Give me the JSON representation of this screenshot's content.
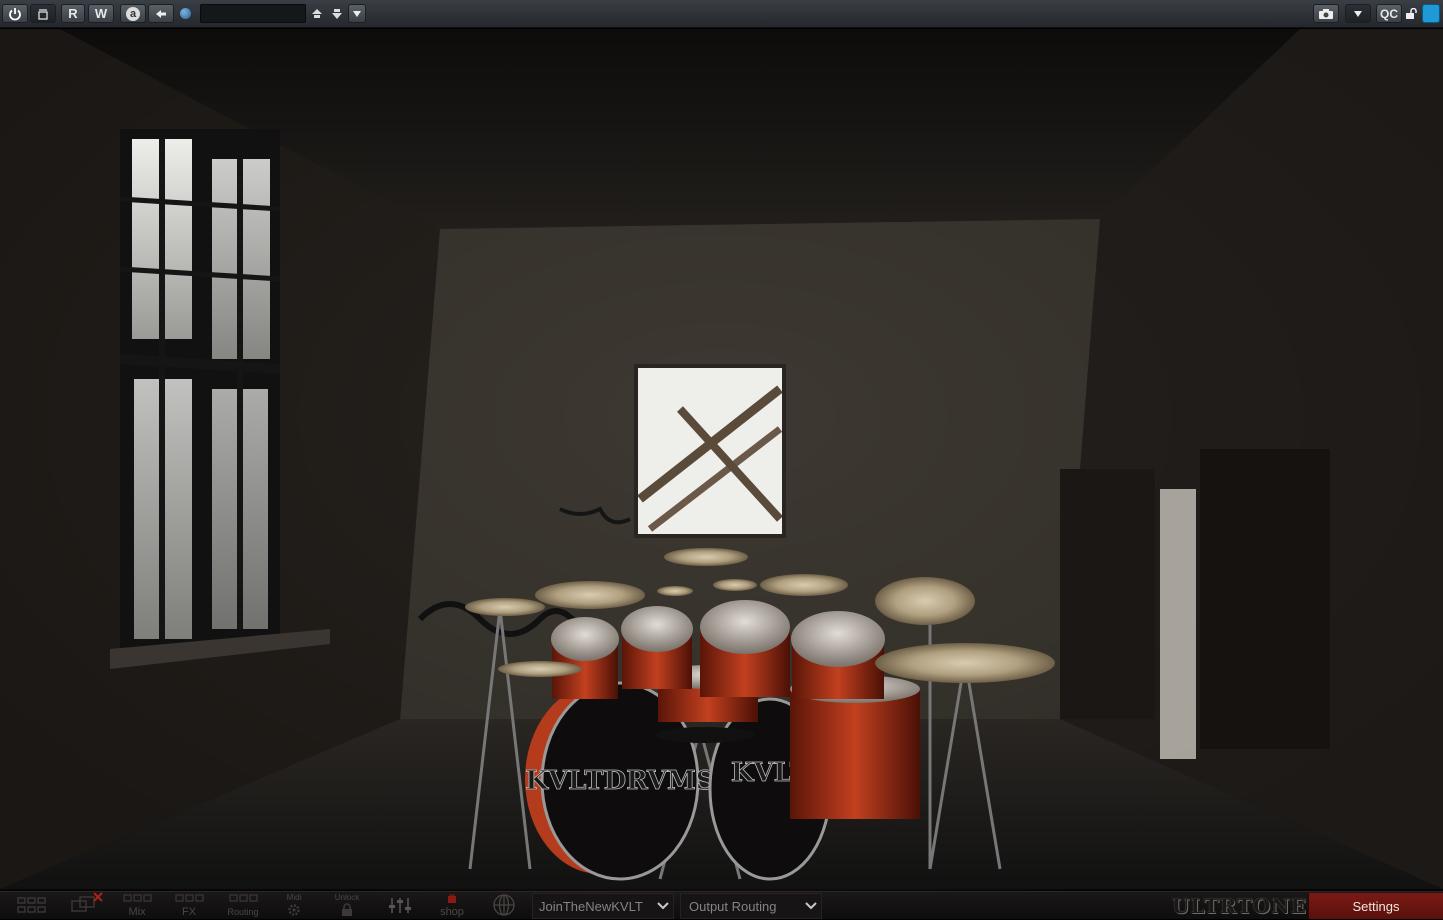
{
  "host_toolbar": {
    "power_icon": "power-icon",
    "compare_icon": "compare-icon",
    "read_label": "R",
    "write_label": "W",
    "auto_label": "a",
    "back_icon": "arrow-left-icon",
    "preset_name": "",
    "qc_label": "QC",
    "colors": {
      "accent": "#1f9ad6"
    }
  },
  "bottom_bar": {
    "items": [
      {
        "label": "",
        "icon": "grid-icon"
      },
      {
        "label": "",
        "icon": "kit-remove-icon"
      },
      {
        "label": "Mix",
        "icon": "mix-icon"
      },
      {
        "label": "FX",
        "icon": "fx-icon"
      },
      {
        "label": "Routing",
        "icon": "routing-icon"
      },
      {
        "label": "Midi",
        "icon": "midi-gear-icon"
      },
      {
        "label": "Unlock",
        "icon": "lock-icon"
      },
      {
        "label": "",
        "icon": "sliders-icon"
      },
      {
        "label": "shop",
        "icon": "shop-icon"
      },
      {
        "label": "",
        "icon": "globe-icon"
      }
    ],
    "kit_select": "JoinTheNewKVLT",
    "output_select": "Output Routing",
    "brand_logo": "ULTRTONE",
    "settings_label": "Settings"
  },
  "scene": {
    "bass_drum_text": "KVLTDRVMS",
    "bass_drum_text_2": "KVLT"
  }
}
